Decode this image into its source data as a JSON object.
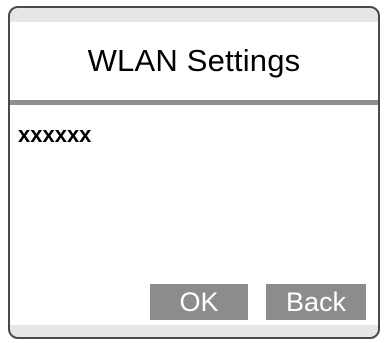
{
  "screen": {
    "title": "WLAN Settings",
    "content": "xxxxxx"
  },
  "buttons": {
    "ok_label": "OK",
    "back_label": "Back"
  },
  "colors": {
    "frame_border": "#4a4a4a",
    "frame_fill": "#e6e6e6",
    "divider": "#8f8f8f",
    "button_fill": "#8c8c8c",
    "button_text": "#ffffff"
  }
}
